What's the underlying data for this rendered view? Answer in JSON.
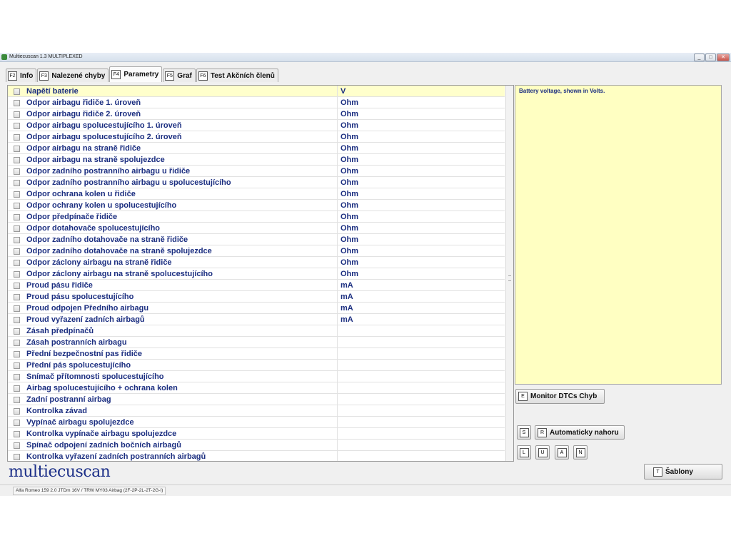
{
  "window": {
    "title": "Multiecuscan 1.3 MULTIPLEXED",
    "controls": {
      "minimize": "_",
      "maximize": "□",
      "close": "✕"
    }
  },
  "tabs": [
    {
      "key": "F2",
      "label": "Info",
      "active": false
    },
    {
      "key": "F3",
      "label": "Nalezené chyby",
      "active": false
    },
    {
      "key": "F4",
      "label": "Parametry",
      "active": true
    },
    {
      "key": "F5",
      "label": "Graf",
      "active": false
    },
    {
      "key": "F6",
      "label": "Test Akčních členů",
      "active": false
    }
  ],
  "parameters": [
    {
      "name": "Napětí baterie",
      "unit": "V",
      "selected": true
    },
    {
      "name": "Odpor airbagu řidiče 1. úroveň",
      "unit": "Ohm"
    },
    {
      "name": "Odpor airbagu řidiče 2. úroveň",
      "unit": "Ohm"
    },
    {
      "name": "Odpor airbagu spolucestujícího 1. úroveň",
      "unit": "Ohm"
    },
    {
      "name": "Odpor airbagu spolucestujícího 2. úroveň",
      "unit": "Ohm"
    },
    {
      "name": "Odpor airbagu na straně řidiče",
      "unit": "Ohm"
    },
    {
      "name": "Odpor airbagu na straně spolujezdce",
      "unit": "Ohm"
    },
    {
      "name": "Odpor zadního postranního airbagu u řidiče",
      "unit": "Ohm"
    },
    {
      "name": "Odpor zadního postranního airbagu u spolucestujícího",
      "unit": "Ohm"
    },
    {
      "name": "Odpor ochrana kolen u řidiče",
      "unit": "Ohm"
    },
    {
      "name": "Odpor ochrany kolen u spolucestujícího",
      "unit": "Ohm"
    },
    {
      "name": "Odpor předpínače řidiče",
      "unit": "Ohm"
    },
    {
      "name": "Odpor dotahovače spolucestujícího",
      "unit": "Ohm"
    },
    {
      "name": "Odpor zadního dotahovače na straně řidiče",
      "unit": "Ohm"
    },
    {
      "name": "Odpor zadního dotahovače na straně spolujezdce",
      "unit": "Ohm"
    },
    {
      "name": "Odpor záclony airbagu na straně řidiče",
      "unit": "Ohm"
    },
    {
      "name": "Odpor záclony airbagu na straně spolucestujícího",
      "unit": "Ohm"
    },
    {
      "name": "Proud pásu řidiče",
      "unit": "mA"
    },
    {
      "name": "Proud pásu spolucestujícího",
      "unit": "mA"
    },
    {
      "name": "Proud odpojen Předního airbagu",
      "unit": "mA"
    },
    {
      "name": "Proud vyřazení zadních airbagů",
      "unit": "mA"
    },
    {
      "name": "Zásah předpínačů",
      "unit": ""
    },
    {
      "name": "Zásah postranních airbagu",
      "unit": ""
    },
    {
      "name": "Přední bezpečnostní pas řidiče",
      "unit": ""
    },
    {
      "name": "Přední pás spolucestujícího",
      "unit": ""
    },
    {
      "name": "Snímač přítomnosti spolucestujícího",
      "unit": ""
    },
    {
      "name": "Airbag spolucestujícího + ochrana kolen",
      "unit": ""
    },
    {
      "name": "Zadní postranní airbag",
      "unit": ""
    },
    {
      "name": "Kontrolka závad",
      "unit": ""
    },
    {
      "name": "Vypínač airbagu spolujezdce",
      "unit": ""
    },
    {
      "name": "Kontrolka vypínače airbagu spolujezdce",
      "unit": ""
    },
    {
      "name": "Spínač odpojení zadních bočních airbagů",
      "unit": ""
    },
    {
      "name": "Kontrolka vyřazení zadních postranních airbagů",
      "unit": ""
    }
  ],
  "description": "Battery voltage, shown in Volts.",
  "buttons": {
    "monitor": {
      "key": "E",
      "label": "Monitor DTCs Chyb"
    },
    "s_key": "S",
    "auto_scroll": {
      "key": "R",
      "label": "Automaticky nahoru"
    },
    "small_keys": [
      "L",
      "U",
      "A",
      "N"
    ],
    "templates": {
      "key": "T",
      "label": "Šablony"
    }
  },
  "logo": "multiecuscan",
  "status": "Alfa Romeo 159 2.0 JTDm 16V / TRW MY03 Airbag (2F-2P-2L-2T-2G-I)",
  "colors": {
    "text_blue": "#1b2e80",
    "selection_yellow": "#ffffcc",
    "description_bg": "#ffffc2"
  }
}
